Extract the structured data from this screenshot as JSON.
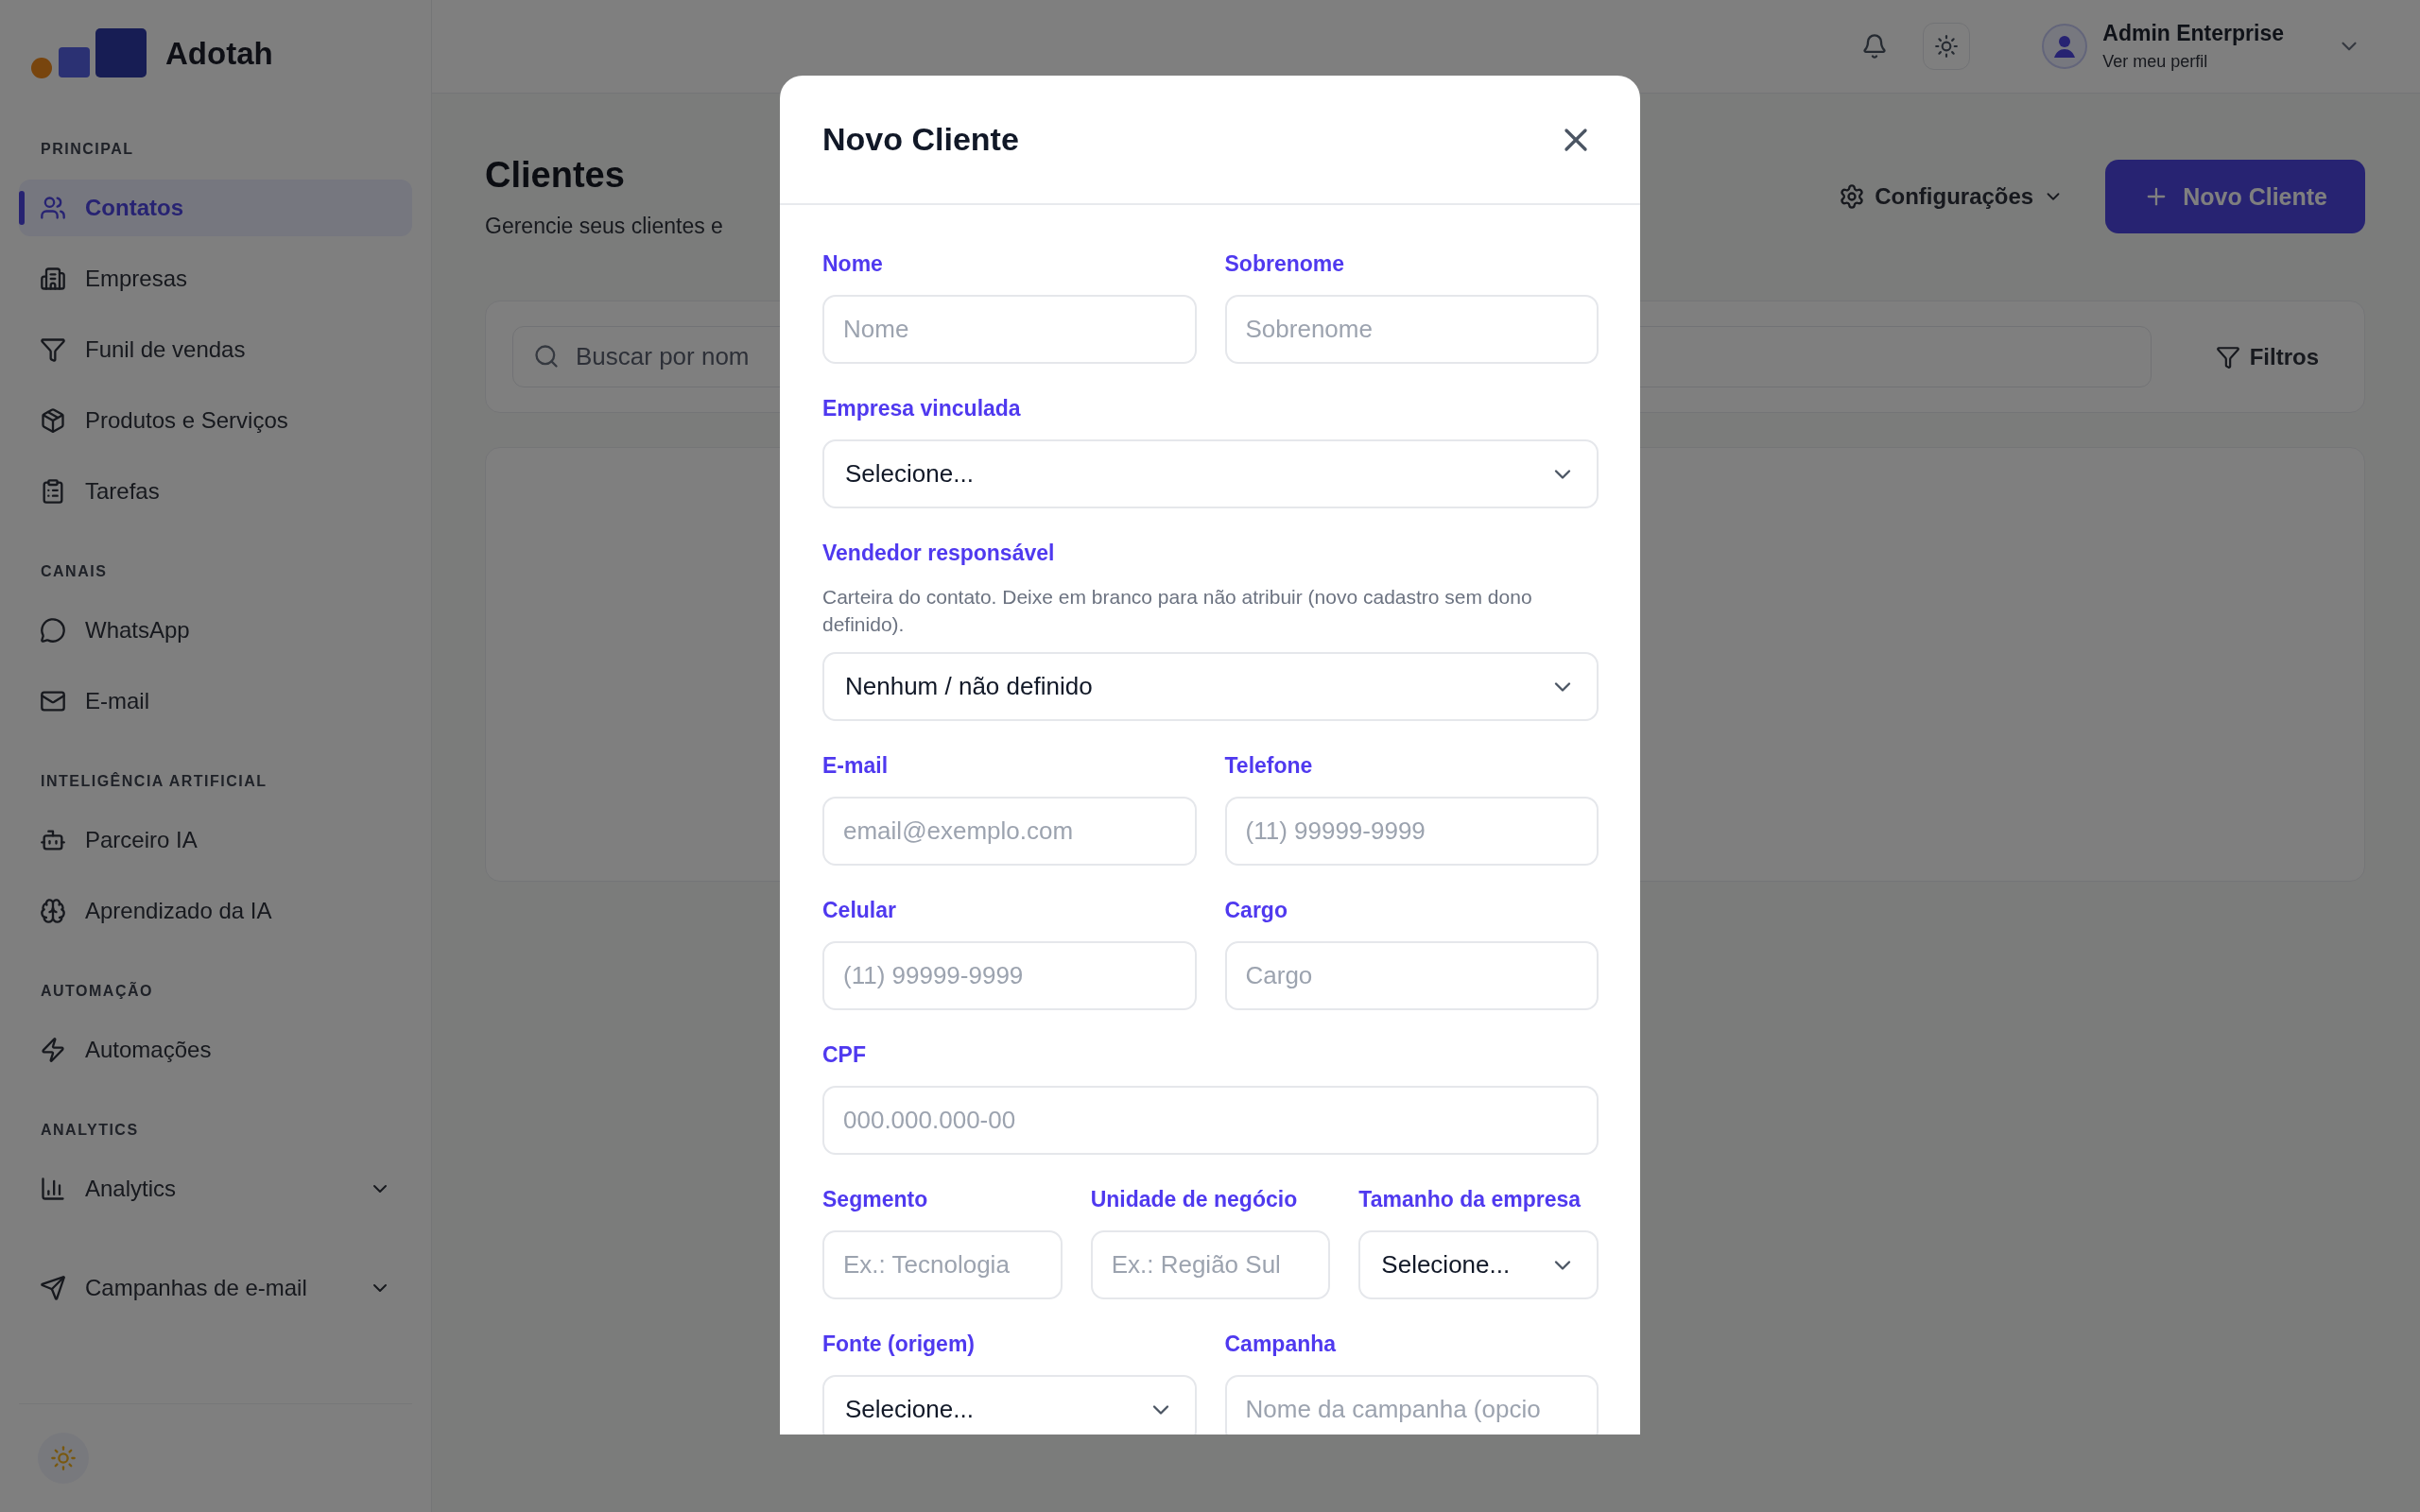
{
  "sidebar": {
    "logo": {
      "name": "Adotah"
    },
    "sections": [
      {
        "heading": "PRINCIPAL",
        "items": [
          {
            "label": "Contatos",
            "kind": "link",
            "selected": true
          },
          {
            "label": "Empresas",
            "kind": "link",
            "selected": false
          },
          {
            "label": "Funil de vendas",
            "kind": "link",
            "selected": false
          },
          {
            "label": "Produtos e Serviços",
            "kind": "link",
            "selected": false
          },
          {
            "label": "Tarefas",
            "kind": "link",
            "selected": false
          }
        ]
      },
      {
        "heading": "CANAIS",
        "items": [
          {
            "label": "WhatsApp",
            "kind": "link",
            "selected": false
          },
          {
            "label": "E-mail",
            "kind": "link",
            "selected": false
          }
        ]
      },
      {
        "heading": "INTELIGÊNCIA ARTIFICIAL",
        "items": [
          {
            "label": "Parceiro IA",
            "kind": "link",
            "selected": false
          },
          {
            "label": "Aprendizado da IA",
            "kind": "link",
            "selected": false
          }
        ]
      },
      {
        "heading": "AUTOMAÇÃO",
        "items": [
          {
            "label": "Automações",
            "kind": "link",
            "selected": false
          }
        ]
      },
      {
        "heading": "ANALYTICS",
        "items": [
          {
            "label": "Analytics",
            "kind": "group",
            "selected": false,
            "expanded": false
          },
          {
            "label": "Campanhas de e-mail",
            "kind": "group",
            "selected": false,
            "expanded": false
          }
        ]
      }
    ]
  },
  "topbar": {
    "user": {
      "name": "Admin Enterprise",
      "subtitle": "Ver meu perfil"
    }
  },
  "page": {
    "title": "Clientes",
    "subtitle": "Gerencie seus clientes e",
    "actions": [
      {
        "label": "Configurações",
        "kind": "menu"
      },
      {
        "label": "Novo Cliente",
        "kind": "primary"
      }
    ],
    "search": {
      "placeholder": "Buscar por nom"
    },
    "filter_button": "Filtros"
  },
  "dialog": {
    "title": "Novo Cliente",
    "rows": [
      {
        "fields": [
          {
            "kind": "text",
            "label": "Nome",
            "placeholder": "Nome"
          },
          {
            "kind": "text",
            "label": "Sobrenome",
            "placeholder": "Sobrenome"
          }
        ]
      },
      {
        "fields": [
          {
            "kind": "select",
            "label": "Empresa vinculada",
            "value": "Selecione..."
          }
        ]
      },
      {
        "fields": [
          {
            "kind": "select",
            "label": "Vendedor responsável",
            "help": "Carteira do contato. Deixe em branco para não atribuir (novo cadastro sem dono definido).",
            "value": "Nenhum / não definido"
          }
        ]
      },
      {
        "fields": [
          {
            "kind": "text",
            "label": "E-mail",
            "placeholder": "email@exemplo.com"
          },
          {
            "kind": "text",
            "label": "Telefone",
            "placeholder": "(11) 99999-9999"
          }
        ]
      },
      {
        "fields": [
          {
            "kind": "text",
            "label": "Celular",
            "placeholder": "(11) 99999-9999"
          },
          {
            "kind": "text",
            "label": "Cargo",
            "placeholder": "Cargo"
          }
        ]
      },
      {
        "fields": [
          {
            "kind": "text",
            "label": "CPF",
            "placeholder": "000.000.000-00"
          }
        ]
      },
      {
        "fields": [
          {
            "kind": "text",
            "label": "Segmento",
            "placeholder": "Ex.: Tecnologia"
          },
          {
            "kind": "text",
            "label": "Unidade de negócio",
            "placeholder": "Ex.: Região Sul"
          },
          {
            "kind": "select",
            "label": "Tamanho da empresa",
            "value": "Selecione..."
          }
        ]
      },
      {
        "fields": [
          {
            "kind": "select",
            "label": "Fonte (origem)",
            "value": "Selecione..."
          },
          {
            "kind": "text",
            "label": "Campanha",
            "placeholder": "Nome da campanha (opcio"
          }
        ]
      }
    ]
  }
}
